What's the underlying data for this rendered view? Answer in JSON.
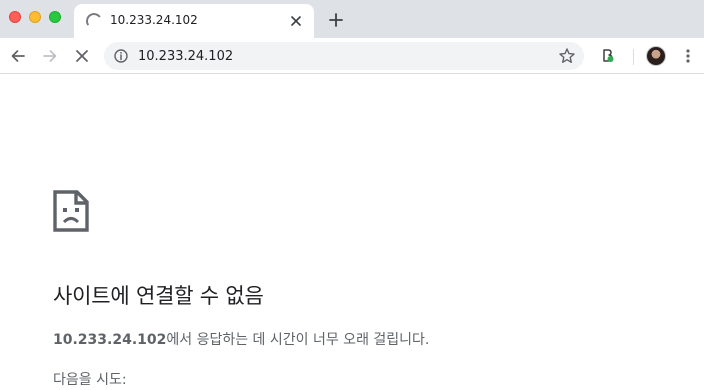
{
  "window": {
    "controls": [
      "close",
      "minimize",
      "maximize"
    ]
  },
  "tab": {
    "title": "10.233.24.102",
    "icon": "loading-spinner-icon",
    "close_icon": "close-icon"
  },
  "new_tab_icon": "plus-icon",
  "toolbar": {
    "back_icon": "arrow-left-icon",
    "forward_icon": "arrow-right-icon",
    "stop_icon": "close-icon",
    "url": "10.233.24.102",
    "info_icon": "info-icon",
    "bookmark_icon": "star-icon",
    "extension_icon": "extension-icon",
    "avatar": "profile-avatar",
    "menu_icon": "more-vert-icon"
  },
  "error": {
    "icon": "broken-page-icon",
    "heading": "사이트에 연결할 수 없음",
    "host": "10.233.24.102",
    "message_rest": "에서 응답하는 데 시간이 너무 오래 걸립니다.",
    "try_label": "다음을 시도:"
  },
  "colors": {
    "tabstrip": "#dee1e6",
    "omnibox": "#f1f3f4",
    "text_primary": "#202124",
    "text_secondary": "#5f6368",
    "traffic_close": "#fe5f57",
    "traffic_min": "#febc2e",
    "traffic_max": "#28c840"
  }
}
